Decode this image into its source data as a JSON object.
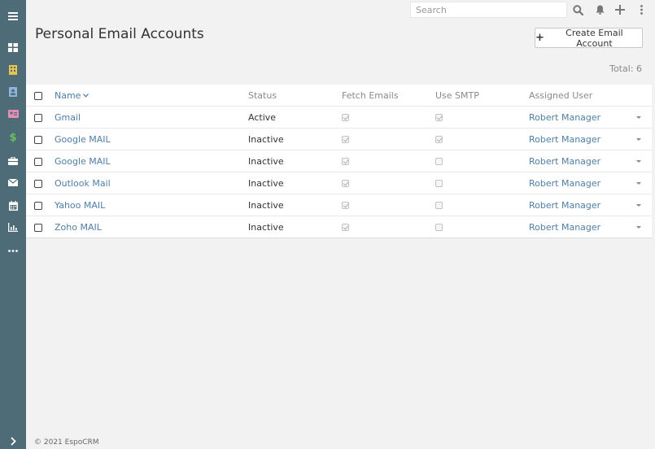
{
  "sidebar": {
    "items": [
      {
        "icon": "menu-icon",
        "color": "#ffffff"
      },
      {
        "icon": "dashboard-icon",
        "color": "#ffffff"
      },
      {
        "icon": "building-icon",
        "color": "#e4c44e"
      },
      {
        "icon": "contact-book-icon",
        "color": "#8fb3d9"
      },
      {
        "icon": "lead-card-icon",
        "color": "#e48fb6"
      },
      {
        "icon": "dollar-icon",
        "color": "#6bbf5f"
      },
      {
        "icon": "briefcase-icon",
        "color": "#ffffff"
      },
      {
        "icon": "envelope-icon",
        "color": "#ffffff"
      },
      {
        "icon": "calendar-icon",
        "color": "#ffffff"
      },
      {
        "icon": "chart-icon",
        "color": "#ffffff"
      },
      {
        "icon": "more-icon",
        "color": "#ffffff"
      },
      {
        "icon": "expand-icon",
        "color": "#ffffff"
      }
    ]
  },
  "topbar": {
    "search_placeholder": "Search",
    "icons": [
      "search-icon",
      "bell-icon",
      "plus-icon",
      "more-vertical-icon"
    ]
  },
  "header": {
    "title": "Personal Email Accounts",
    "create_button": "Create Email Account",
    "total": "Total: 6"
  },
  "table": {
    "columns": [
      "Name",
      "Status",
      "Fetch Emails",
      "Use SMTP",
      "Assigned User"
    ],
    "rows": [
      {
        "name": "Gmail",
        "status": "Active",
        "fetch": true,
        "smtp": true,
        "user": "Robert Manager"
      },
      {
        "name": "Google MAIL",
        "status": "Inactive",
        "fetch": true,
        "smtp": true,
        "user": "Robert Manager"
      },
      {
        "name": "Google MAIL",
        "status": "Inactive",
        "fetch": true,
        "smtp": false,
        "user": "Robert Manager"
      },
      {
        "name": "Outlook Mail",
        "status": "Inactive",
        "fetch": true,
        "smtp": false,
        "user": "Robert Manager"
      },
      {
        "name": "Yahoo MAIL",
        "status": "Inactive",
        "fetch": true,
        "smtp": false,
        "user": "Robert Manager"
      },
      {
        "name": "Zoho MAIL",
        "status": "Inactive",
        "fetch": true,
        "smtp": false,
        "user": "Robert Manager"
      }
    ]
  },
  "footer": {
    "text": "© 2021 EspoCRM"
  },
  "colors": {
    "sidebar": "#4e6b78",
    "link": "#4f7ea6",
    "background": "#f2f2f2"
  }
}
